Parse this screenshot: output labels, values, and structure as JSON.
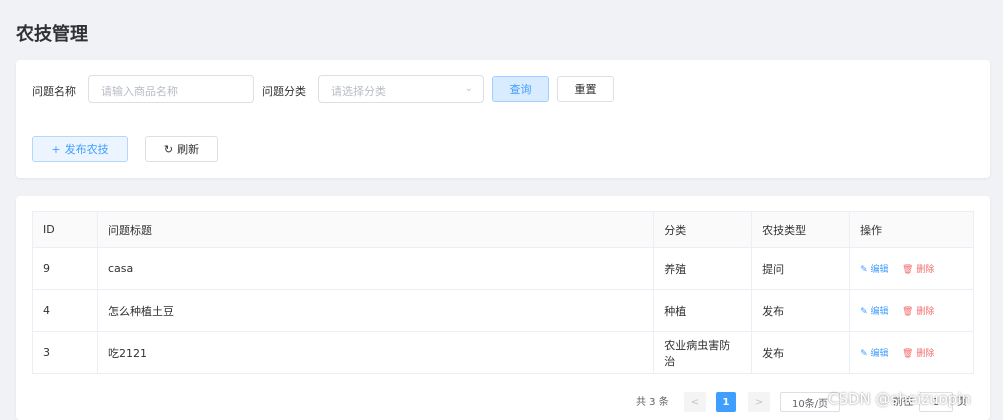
{
  "page": {
    "title": "农技管理"
  },
  "filter": {
    "name_label": "问题名称",
    "name_placeholder": "请输入商品名称",
    "category_label": "问题分类",
    "category_placeholder": "请选择分类",
    "query_label": "查询",
    "reset_label": "重置",
    "add_label": "发布农技",
    "refresh_label": "刷新"
  },
  "table": {
    "headers": [
      "ID",
      "问题标题",
      "分类",
      "农技类型",
      "操作"
    ],
    "rows": [
      {
        "id": "9",
        "title": "casa",
        "category": "养殖",
        "type": "提问"
      },
      {
        "id": "4",
        "title": "怎么种植土豆",
        "category": "种植",
        "type": "发布"
      },
      {
        "id": "3",
        "title": "吃2121",
        "category": "农业病虫害防治",
        "type": "发布"
      }
    ],
    "edit_label": "编辑",
    "delete_label": "删除"
  },
  "pagination": {
    "total": "共 3 条",
    "current_page": "1",
    "page_size": "10条/页",
    "goto_label": "前往",
    "goto_value": "1",
    "goto_suffix": "页"
  },
  "watermark": "CSDN @sheizuopin",
  "colors": {
    "primary": "#409eff",
    "danger": "#f56c6c",
    "background": "#f0f2f5"
  }
}
